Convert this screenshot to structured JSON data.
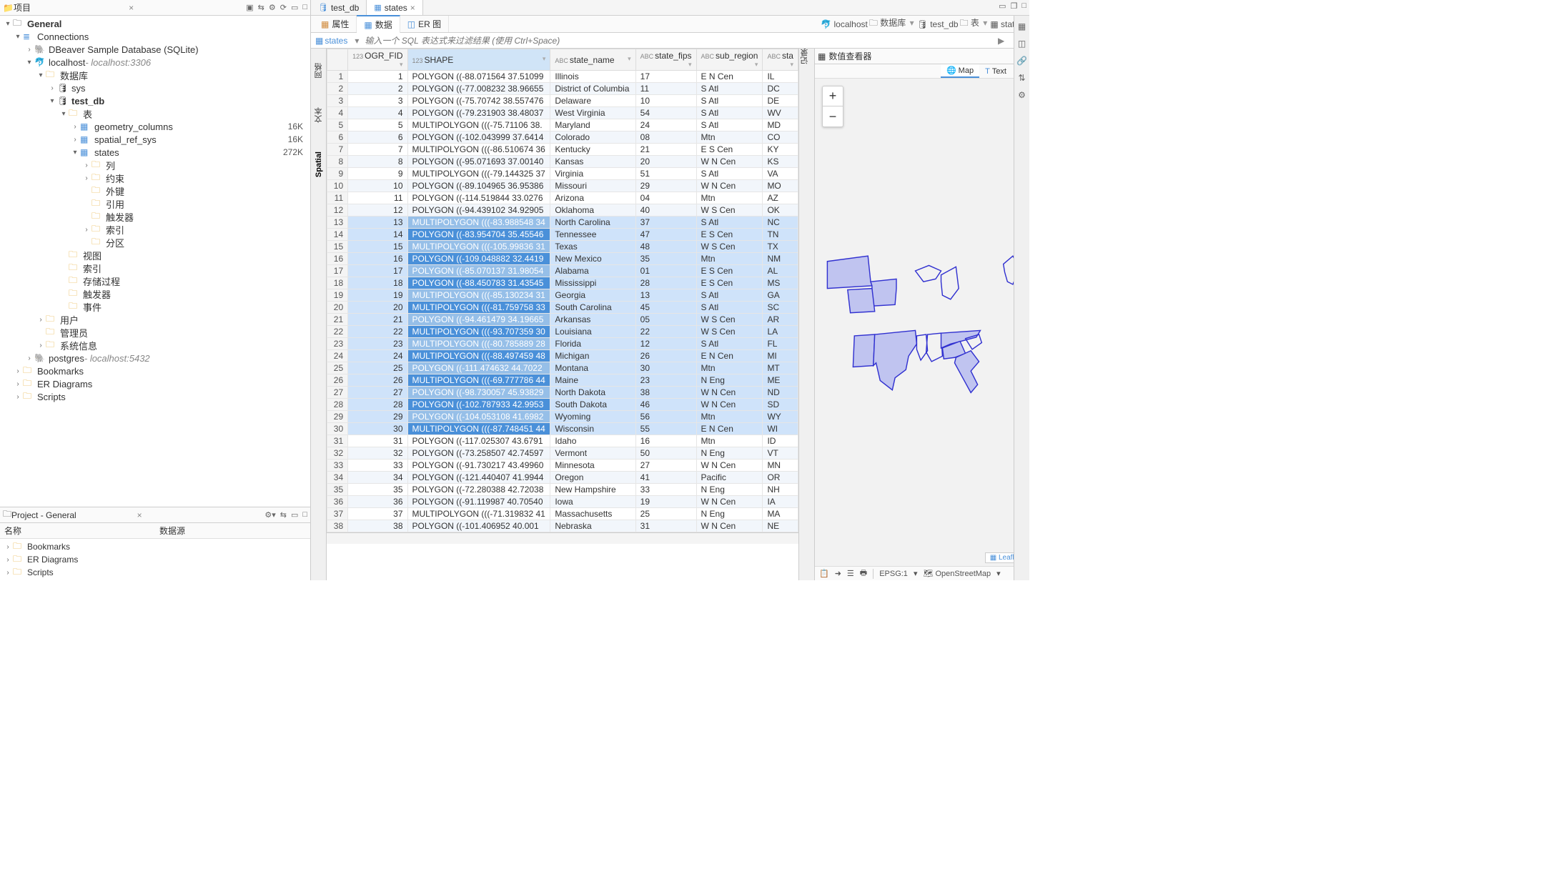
{
  "panels": {
    "project_tab": "项目",
    "general": "General",
    "connections": "Connections",
    "sample_db": "DBeaver Sample Database (SQLite)",
    "localhost_mysql": "localhost",
    "localhost_mysql_suffix": " - localhost:3306",
    "databases": "数据库",
    "sys": "sys",
    "test_db": "test_db",
    "tables": "表",
    "geom_cols": "geometry_columns",
    "geom_cols_size": "16K",
    "spatial_ref": "spatial_ref_sys",
    "spatial_ref_size": "16K",
    "states": "states",
    "states_size": "272K",
    "columns": "列",
    "constraints": "约束",
    "fks": "外键",
    "refs": "引用",
    "triggers_t": "触发器",
    "indexes": "索引",
    "partitions": "分区",
    "views": "视图",
    "db_indexes": "索引",
    "procedures": "存储过程",
    "triggers": "触发器",
    "events": "事件",
    "users": "用户",
    "admin": "管理员",
    "sysinfo": "系统信息",
    "postgres": "postgres",
    "postgres_suffix": "  - localhost:5432",
    "bookmarks": "Bookmarks",
    "er_diagrams": "ER Diagrams",
    "scripts": "Scripts",
    "project_general": "Project - General",
    "col_name": "名称",
    "col_datasource": "数据源"
  },
  "editor": {
    "tab1": "test_db",
    "tab2": "states",
    "sub_props": "属性",
    "sub_data": "数据",
    "sub_er": "ER 图",
    "bc_localhost": "localhost",
    "bc_db": "数据库",
    "bc_test_db": "test_db",
    "bc_tables": "表",
    "bc_states": "states",
    "filter_label": "states",
    "filter_ph": "输入一个 SQL 表达式来过滤结果 (使用 Ctrl+Space)"
  },
  "grid": {
    "gutter_label1": "网格",
    "gutter_label2": "文本",
    "gutter_label3": "Spatial",
    "cols": [
      "OGR_FID",
      "SHAPE",
      "state_name",
      "state_fips",
      "sub_region",
      "sta"
    ],
    "col_types": [
      "123",
      "123",
      "ABC",
      "ABC",
      "ABC",
      "ABC"
    ]
  },
  "rows": [
    {
      "n": 1,
      "fid": 1,
      "shape": "POLYGON ((-88.071564 37.51099",
      "name": "Illinois",
      "fips": "17",
      "sub": "E N Cen",
      "ab": "IL",
      "sel": 0
    },
    {
      "n": 2,
      "fid": 2,
      "shape": "POLYGON ((-77.008232 38.96655",
      "name": "District of Columbia",
      "fips": "11",
      "sub": "S Atl",
      "ab": "DC",
      "sel": 0
    },
    {
      "n": 3,
      "fid": 3,
      "shape": "POLYGON ((-75.70742 38.557476",
      "name": "Delaware",
      "fips": "10",
      "sub": "S Atl",
      "ab": "DE",
      "sel": 0
    },
    {
      "n": 4,
      "fid": 4,
      "shape": "POLYGON ((-79.231903 38.48037",
      "name": "West Virginia",
      "fips": "54",
      "sub": "S Atl",
      "ab": "WV",
      "sel": 0
    },
    {
      "n": 5,
      "fid": 5,
      "shape": "MULTIPOLYGON (((-75.71106 38.",
      "name": "Maryland",
      "fips": "24",
      "sub": "S Atl",
      "ab": "MD",
      "sel": 0
    },
    {
      "n": 6,
      "fid": 6,
      "shape": "POLYGON ((-102.043999 37.6414",
      "name": "Colorado",
      "fips": "08",
      "sub": "Mtn",
      "ab": "CO",
      "sel": 0
    },
    {
      "n": 7,
      "fid": 7,
      "shape": "MULTIPOLYGON (((-86.510674 36",
      "name": "Kentucky",
      "fips": "21",
      "sub": "E S Cen",
      "ab": "KY",
      "sel": 0
    },
    {
      "n": 8,
      "fid": 8,
      "shape": "POLYGON ((-95.071693 37.00140",
      "name": "Kansas",
      "fips": "20",
      "sub": "W N Cen",
      "ab": "KS",
      "sel": 0
    },
    {
      "n": 9,
      "fid": 9,
      "shape": "MULTIPOLYGON (((-79.144325 37",
      "name": "Virginia",
      "fips": "51",
      "sub": "S Atl",
      "ab": "VA",
      "sel": 0
    },
    {
      "n": 10,
      "fid": 10,
      "shape": "POLYGON ((-89.104965 36.95386",
      "name": "Missouri",
      "fips": "29",
      "sub": "W N Cen",
      "ab": "MO",
      "sel": 0
    },
    {
      "n": 11,
      "fid": 11,
      "shape": "POLYGON ((-114.519844 33.0276",
      "name": "Arizona",
      "fips": "04",
      "sub": "Mtn",
      "ab": "AZ",
      "sel": 0
    },
    {
      "n": 12,
      "fid": 12,
      "shape": "POLYGON ((-94.439102 34.92905",
      "name": "Oklahoma",
      "fips": "40",
      "sub": "W S Cen",
      "ab": "OK",
      "sel": 0
    },
    {
      "n": 13,
      "fid": 13,
      "shape": "MULTIPOLYGON (((-83.988548 34",
      "name": "North Carolina",
      "fips": "37",
      "sub": "S Atl",
      "ab": "NC",
      "sel": 2
    },
    {
      "n": 14,
      "fid": 14,
      "shape": "POLYGON ((-83.954704 35.45546",
      "name": "Tennessee",
      "fips": "47",
      "sub": "E S Cen",
      "ab": "TN",
      "sel": 1
    },
    {
      "n": 15,
      "fid": 15,
      "shape": "MULTIPOLYGON (((-105.99836 31",
      "name": "Texas",
      "fips": "48",
      "sub": "W S Cen",
      "ab": "TX",
      "sel": 2
    },
    {
      "n": 16,
      "fid": 16,
      "shape": "POLYGON ((-109.048882 32.4419",
      "name": "New Mexico",
      "fips": "35",
      "sub": "Mtn",
      "ab": "NM",
      "sel": 1
    },
    {
      "n": 17,
      "fid": 17,
      "shape": "POLYGON ((-85.070137 31.98054",
      "name": "Alabama",
      "fips": "01",
      "sub": "E S Cen",
      "ab": "AL",
      "sel": 2
    },
    {
      "n": 18,
      "fid": 18,
      "shape": "POLYGON ((-88.450783 31.43545",
      "name": "Mississippi",
      "fips": "28",
      "sub": "E S Cen",
      "ab": "MS",
      "sel": 1
    },
    {
      "n": 19,
      "fid": 19,
      "shape": "MULTIPOLYGON (((-85.130234 31",
      "name": "Georgia",
      "fips": "13",
      "sub": "S Atl",
      "ab": "GA",
      "sel": 2
    },
    {
      "n": 20,
      "fid": 20,
      "shape": "MULTIPOLYGON (((-81.759758 33",
      "name": "South Carolina",
      "fips": "45",
      "sub": "S Atl",
      "ab": "SC",
      "sel": 1
    },
    {
      "n": 21,
      "fid": 21,
      "shape": "POLYGON ((-94.461479 34.19665",
      "name": "Arkansas",
      "fips": "05",
      "sub": "W S Cen",
      "ab": "AR",
      "sel": 2
    },
    {
      "n": 22,
      "fid": 22,
      "shape": "MULTIPOLYGON (((-93.707359 30",
      "name": "Louisiana",
      "fips": "22",
      "sub": "W S Cen",
      "ab": "LA",
      "sel": 1
    },
    {
      "n": 23,
      "fid": 23,
      "shape": "MULTIPOLYGON (((-80.785889 28",
      "name": "Florida",
      "fips": "12",
      "sub": "S Atl",
      "ab": "FL",
      "sel": 2
    },
    {
      "n": 24,
      "fid": 24,
      "shape": "MULTIPOLYGON (((-88.497459 48",
      "name": "Michigan",
      "fips": "26",
      "sub": "E N Cen",
      "ab": "MI",
      "sel": 1
    },
    {
      "n": 25,
      "fid": 25,
      "shape": "POLYGON ((-111.474632 44.7022",
      "name": "Montana",
      "fips": "30",
      "sub": "Mtn",
      "ab": "MT",
      "sel": 2
    },
    {
      "n": 26,
      "fid": 26,
      "shape": "MULTIPOLYGON (((-69.777786 44",
      "name": "Maine",
      "fips": "23",
      "sub": "N Eng",
      "ab": "ME",
      "sel": 1
    },
    {
      "n": 27,
      "fid": 27,
      "shape": "POLYGON ((-98.730057 45.93829",
      "name": "North Dakota",
      "fips": "38",
      "sub": "W N Cen",
      "ab": "ND",
      "sel": 2
    },
    {
      "n": 28,
      "fid": 28,
      "shape": "POLYGON ((-102.787933 42.9953",
      "name": "South Dakota",
      "fips": "46",
      "sub": "W N Cen",
      "ab": "SD",
      "sel": 1
    },
    {
      "n": 29,
      "fid": 29,
      "shape": "POLYGON ((-104.053108 41.6982",
      "name": "Wyoming",
      "fips": "56",
      "sub": "Mtn",
      "ab": "WY",
      "sel": 2
    },
    {
      "n": 30,
      "fid": 30,
      "shape": "MULTIPOLYGON (((-87.748451 44",
      "name": "Wisconsin",
      "fips": "55",
      "sub": "E N Cen",
      "ab": "WI",
      "sel": 1
    },
    {
      "n": 31,
      "fid": 31,
      "shape": "POLYGON ((-117.025307 43.6791",
      "name": "Idaho",
      "fips": "16",
      "sub": "Mtn",
      "ab": "ID",
      "sel": 0
    },
    {
      "n": 32,
      "fid": 32,
      "shape": "POLYGON ((-73.258507 42.74597",
      "name": "Vermont",
      "fips": "50",
      "sub": "N Eng",
      "ab": "VT",
      "sel": 0
    },
    {
      "n": 33,
      "fid": 33,
      "shape": "POLYGON ((-91.730217 43.49960",
      "name": "Minnesota",
      "fips": "27",
      "sub": "W N Cen",
      "ab": "MN",
      "sel": 0
    },
    {
      "n": 34,
      "fid": 34,
      "shape": "POLYGON ((-121.440407 41.9944",
      "name": "Oregon",
      "fips": "41",
      "sub": "Pacific",
      "ab": "OR",
      "sel": 0
    },
    {
      "n": 35,
      "fid": 35,
      "shape": "POLYGON ((-72.280388 42.72038",
      "name": "New Hampshire",
      "fips": "33",
      "sub": "N Eng",
      "ab": "NH",
      "sel": 0
    },
    {
      "n": 36,
      "fid": 36,
      "shape": "POLYGON ((-91.119987 40.70540",
      "name": "Iowa",
      "fips": "19",
      "sub": "W N Cen",
      "ab": "IA",
      "sel": 0
    },
    {
      "n": 37,
      "fid": 37,
      "shape": "MULTIPOLYGON (((-71.319832 41",
      "name": "Massachusetts",
      "fips": "25",
      "sub": "N Eng",
      "ab": "MA",
      "sel": 0
    },
    {
      "n": 38,
      "fid": 38,
      "shape": "POLYGON ((-101.406952 40.001",
      "name": "Nebraska",
      "fips": "31",
      "sub": "W N Cen",
      "ab": "NE",
      "sel": 0
    }
  ],
  "viewer": {
    "title": "数值查看器",
    "tab_map": "Map",
    "tab_text": "Text",
    "leaflet": "Leaflet",
    "zoom_in": "+",
    "zoom_out": "−",
    "epsg": "EPSG:1",
    "basemap": "OpenStreetMap"
  }
}
